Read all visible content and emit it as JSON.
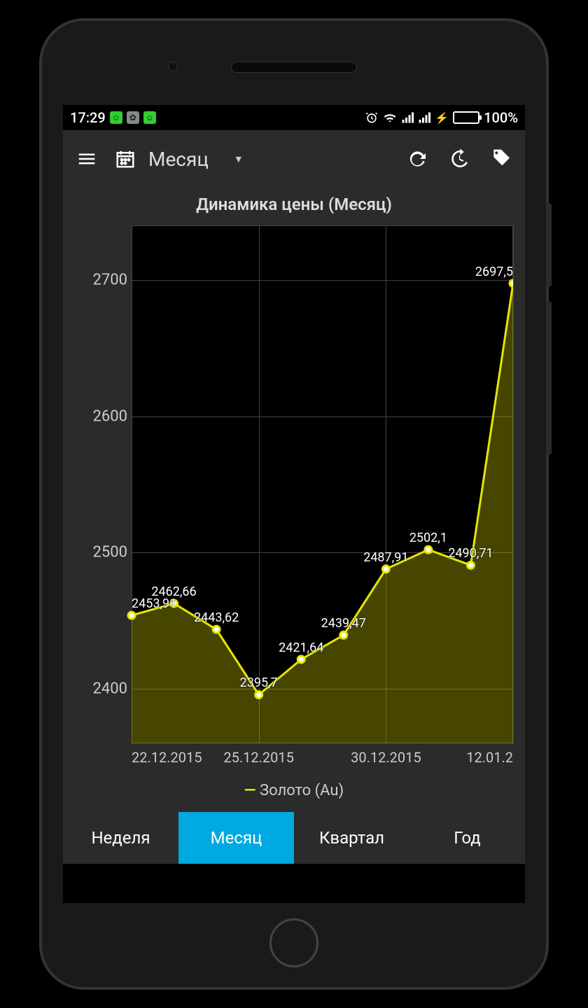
{
  "status": {
    "time": "17:29",
    "battery_pct": "100%"
  },
  "appbar": {
    "period_label": "Месяц"
  },
  "chart_title": "Динамика цены (Месяц)",
  "legend": "Золото (Au)",
  "tabs": {
    "week": "Неделя",
    "month": "Месяц",
    "quarter": "Квартал",
    "year": "Год",
    "active": "month"
  },
  "chart_data": {
    "type": "line",
    "title": "Динамика цены (Месяц)",
    "ylabel": "",
    "xlabel": "",
    "ylim": [
      2360,
      2740
    ],
    "y_ticks": [
      2400,
      2500,
      2600,
      2700
    ],
    "x_tick_labels": [
      "22.12.2015",
      "25.12.2015",
      "30.12.2015",
      "12.01.2"
    ],
    "series": [
      {
        "name": "Золото (Au)",
        "color": "#e6e600",
        "values": [
          2453.91,
          2462.66,
          2443.62,
          2395.7,
          2421.64,
          2439.47,
          2487.91,
          2502.1,
          2490.71,
          2697.5
        ],
        "labels": [
          "2453,91",
          "2462,66",
          "2443,62",
          "2395,7",
          "2421,64",
          "2439,47",
          "2487,91",
          "2502,1",
          "2490,71",
          "2697,5"
        ]
      }
    ]
  }
}
